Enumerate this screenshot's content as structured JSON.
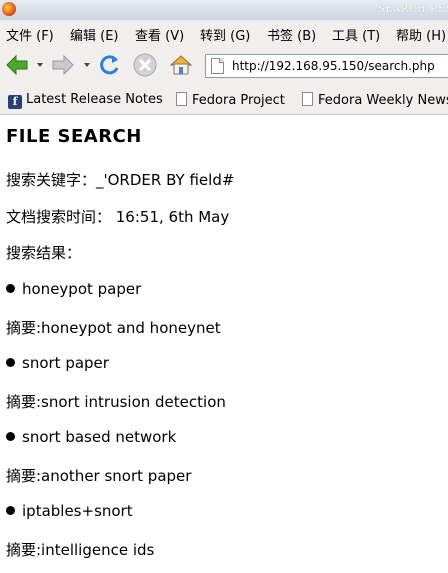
{
  "window": {
    "title": "SEARCH RES"
  },
  "menu": [
    {
      "label": "文件 (F)"
    },
    {
      "label": "编辑 (E)"
    },
    {
      "label": "查看 (V)"
    },
    {
      "label": "转到 (G)"
    },
    {
      "label": "书签 (B)"
    },
    {
      "label": "工具 (T)"
    },
    {
      "label": "帮助 (H)"
    }
  ],
  "toolbar": {
    "url": "http://192.168.95.150/search.php",
    "icons": [
      "back-arrow-icon",
      "forward-arrow-icon",
      "reload-icon",
      "stop-icon",
      "home-icon"
    ]
  },
  "bookmarks": [
    {
      "label": "Latest Release Notes",
      "icon": "fedora-icon"
    },
    {
      "label": "Fedora Project",
      "icon": "page-icon"
    },
    {
      "label": "Fedora Weekly News",
      "icon": "page-icon"
    }
  ],
  "page": {
    "heading": "FILE  SEARCH",
    "keyword_line": "搜索关键字：_'ORDER BY field#",
    "time_line": "文档搜索时间： 16:51, 6th May",
    "results_label": "搜索结果：",
    "results": [
      {
        "title": "honeypot paper",
        "summary": "摘要:honeypot and honeynet"
      },
      {
        "title": "snort paper",
        "summary": "摘要:snort intrusion detection"
      },
      {
        "title": "snort based network",
        "summary": "摘要:another snort paper"
      },
      {
        "title": "iptables+snort",
        "summary": "摘要:intelligence ids"
      }
    ]
  }
}
